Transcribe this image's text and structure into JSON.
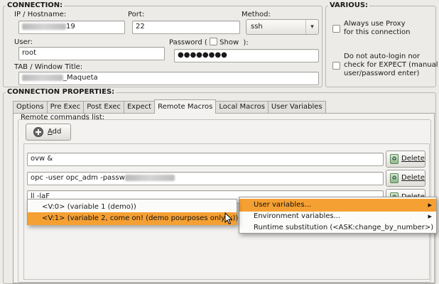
{
  "connection": {
    "title": "CONNECTION:",
    "ip_label": "IP / Hostname:",
    "ip_value_visible": "19",
    "port_label": "Port:",
    "port_value": "22",
    "method_label": "Method:",
    "method_value": "ssh",
    "user_label": "User:",
    "user_value": "root",
    "password_label": "Password (",
    "show_label": "Show",
    "password_suffix": "):",
    "password_value": "●●●●●●●●",
    "tab_title_label": "TAB / Window Title:",
    "tab_title_visible": "_Maqueta"
  },
  "various": {
    "title": "VARIOUS:",
    "proxy_line1": "Always use Proxy",
    "proxy_line2": "for this connection",
    "autologin_line1": "Do not auto-login nor",
    "autologin_line2": "check for EXPECT (manual",
    "autologin_line3": "user/password enter)"
  },
  "properties": {
    "title": "CONNECTION PROPERTIES:",
    "tabs": [
      {
        "label": "Options"
      },
      {
        "label": "Pre Exec"
      },
      {
        "label": "Post Exec"
      },
      {
        "label": "Expect"
      },
      {
        "label": "Remote Macros"
      },
      {
        "label": "Local Macros"
      },
      {
        "label": "User Variables"
      }
    ],
    "remote_commands_label": "Remote commands list:",
    "add_label": "Add",
    "commands": [
      {
        "value": "ovw &",
        "delete": "Delete"
      },
      {
        "value_visible": "opc -user opc_adm -passw",
        "delete": "Delete"
      },
      {
        "value_visible": "ll -laF",
        "delete": "Delete"
      }
    ]
  },
  "context_menu": {
    "items": [
      {
        "label": "User variables..."
      },
      {
        "label": "Environment variables..."
      },
      {
        "label": "Runtime substitution (<ASK:change_by_number>)"
      }
    ]
  },
  "submenu": {
    "items": [
      {
        "label": "<V:0> (variable 1 (demo))"
      },
      {
        "label": "<V:1> (variable 2, come on! (demo pourposes only! ;))"
      }
    ]
  },
  "colors": {
    "highlight": "#f5a033",
    "background": "#ecebe8"
  }
}
